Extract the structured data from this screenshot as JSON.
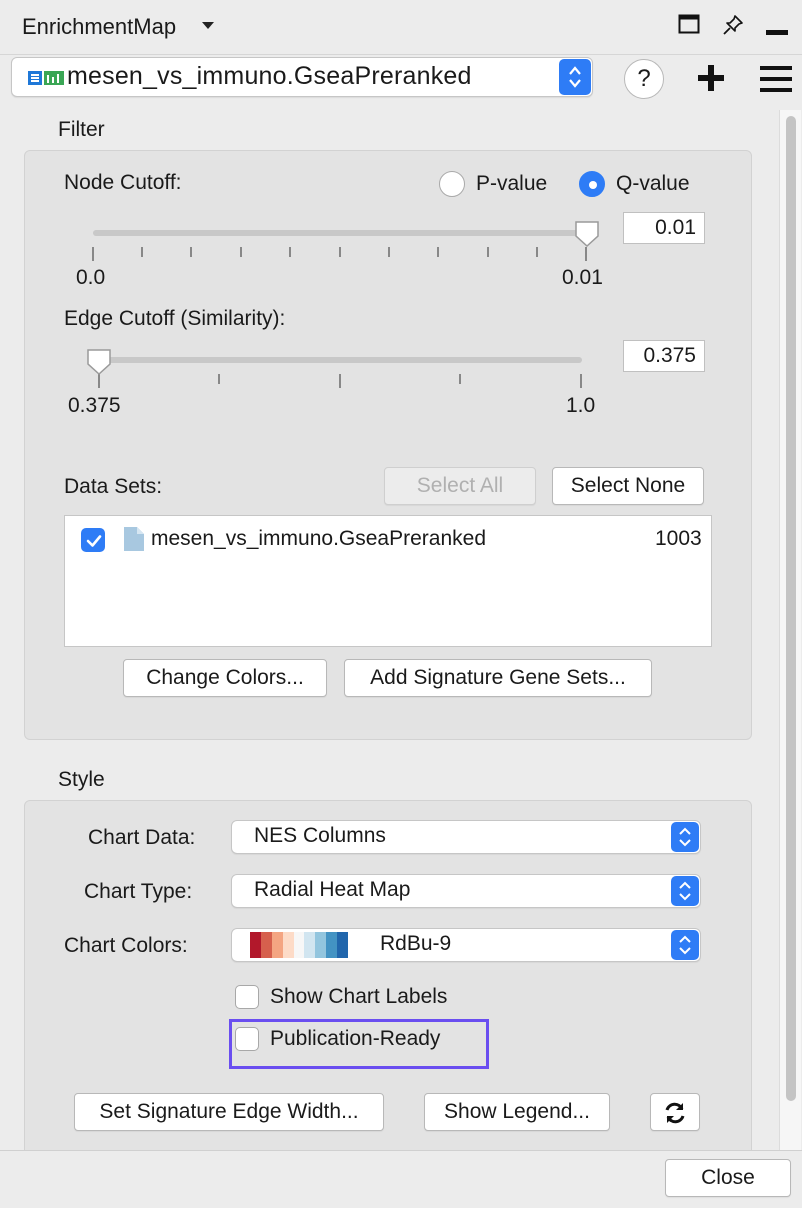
{
  "titlebar": {
    "title": "EnrichmentMap",
    "icons": [
      "maximize-icon",
      "pin-icon",
      "minimize-icon"
    ]
  },
  "network": {
    "selected": "mesen_vs_immuno.GseaPreranked",
    "help_label": "?"
  },
  "filter": {
    "section_label": "Filter",
    "node_cutoff": {
      "label": "Node Cutoff:",
      "options": [
        "P-value",
        "Q-value"
      ],
      "selected": "Q-value",
      "min_label": "0.0",
      "max_label": "0.01",
      "value": "0.01"
    },
    "edge_cutoff": {
      "label": "Edge Cutoff (Similarity):",
      "min_label": "0.375",
      "max_label": "1.0",
      "value": "0.375"
    },
    "data_sets": {
      "label": "Data Sets:",
      "select_all": "Select All",
      "select_none": "Select None",
      "items": [
        {
          "name": "mesen_vs_immuno.GseaPreranked",
          "count": "1003",
          "checked": true
        }
      ]
    },
    "change_colors": "Change Colors...",
    "add_signature": "Add Signature Gene Sets..."
  },
  "style": {
    "section_label": "Style",
    "chart_data_label": "Chart Data:",
    "chart_data_value": "NES Columns",
    "chart_type_label": "Chart Type:",
    "chart_type_value": "Radial Heat Map",
    "chart_colors_label": "Chart Colors:",
    "chart_colors_value": "RdBu-9",
    "palette": [
      "#b2182b",
      "#d6604d",
      "#f4a582",
      "#fddbc7",
      "#f7f7f7",
      "#d1e5f0",
      "#92c5de",
      "#4393c3",
      "#2166ac"
    ],
    "show_chart_labels": "Show Chart Labels",
    "publication_ready": "Publication-Ready",
    "set_signature_edge_width": "Set Signature Edge Width...",
    "show_legend": "Show Legend..."
  },
  "footer": {
    "close": "Close"
  },
  "colors": {
    "accent": "#2e7cf6",
    "highlight": "#6a4ef0"
  }
}
